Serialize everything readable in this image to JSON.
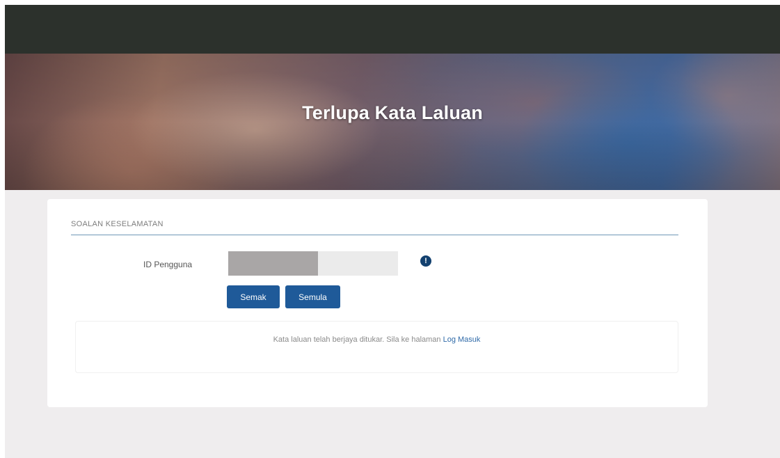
{
  "hero": {
    "title": "Terlupa Kata Laluan"
  },
  "form": {
    "section_title": "SOALAN KESELAMATAN",
    "user_id_label": "ID Pengguna",
    "user_id_value": "",
    "check_button": "Semak",
    "reset_button": "Semula",
    "info_icon": "info-circle-icon",
    "info_glyph": "!"
  },
  "message": {
    "text": "Kata laluan telah berjaya ditukar. Sila ke halaman ",
    "link_label": "Log Masuk"
  },
  "colors": {
    "topbar": "#2c312c",
    "background": "#efedee",
    "button": "#1f5a99",
    "section_rule": "#6f98b6",
    "link": "#2f6aa8",
    "info_icon": "#13416f",
    "input_mask": "#a9a6a6"
  }
}
